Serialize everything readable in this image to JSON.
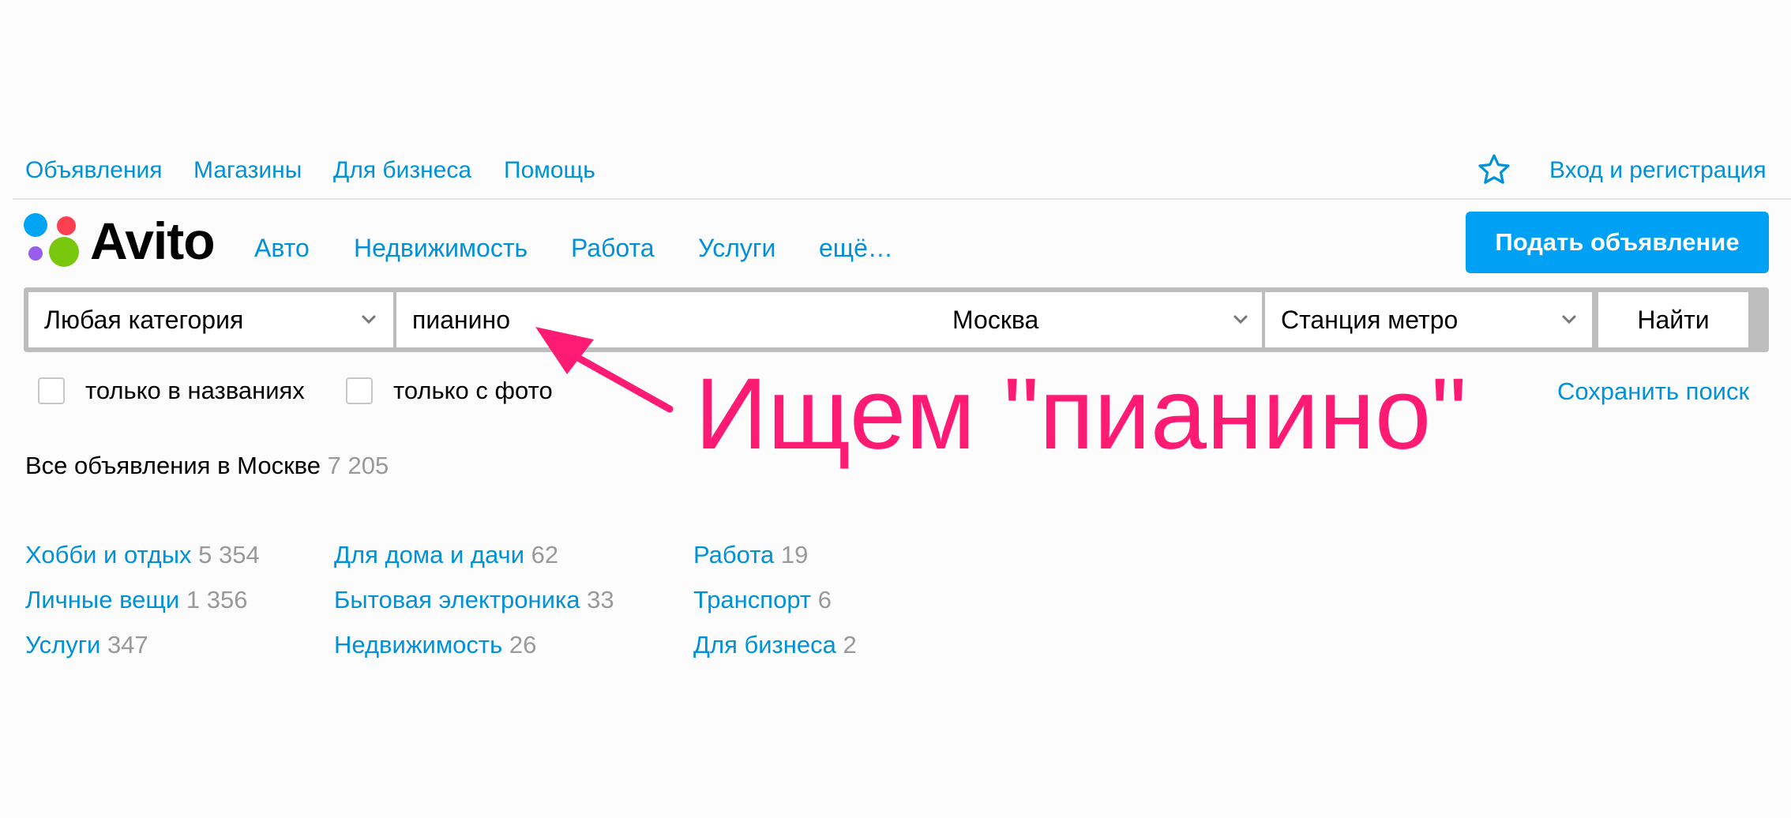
{
  "topnav": {
    "links": [
      "Объявления",
      "Магазины",
      "Для бизнеса",
      "Помощь"
    ],
    "login": "Вход и регистрация",
    "favorites_icon": "star-icon"
  },
  "header": {
    "logo_text": "Avito",
    "categories": [
      "Авто",
      "Недвижимость",
      "Работа",
      "Услуги",
      "ещё…"
    ],
    "post_button": "Подать объявление",
    "accent_color": "#00a1f5"
  },
  "search": {
    "category": "Любая категория",
    "query": "пианино",
    "city": "Москва",
    "metro": "Станция метро",
    "find_button": "Найти"
  },
  "filters": {
    "titles_only": {
      "label": "только в названиях",
      "checked": false
    },
    "with_photo": {
      "label": "только с фото",
      "checked": false
    },
    "save_search": "Сохранить поиск"
  },
  "results": {
    "all_label": "Все объявления в Москве",
    "all_count": "7 205",
    "categories": [
      {
        "name": "Хобби и отдых",
        "count": "5 354"
      },
      {
        "name": "Личные вещи",
        "count": "1 356"
      },
      {
        "name": "Услуги",
        "count": "347"
      },
      {
        "name": "Для дома и дачи",
        "count": "62"
      },
      {
        "name": "Бытовая электроника",
        "count": "33"
      },
      {
        "name": "Недвижимость",
        "count": "26"
      },
      {
        "name": "Работа",
        "count": "19"
      },
      {
        "name": "Транспорт",
        "count": "6"
      },
      {
        "name": "Для бизнеса",
        "count": "2"
      }
    ]
  },
  "annotation": {
    "text": "Ищем \"пианино\"",
    "color": "#ff1a74"
  }
}
